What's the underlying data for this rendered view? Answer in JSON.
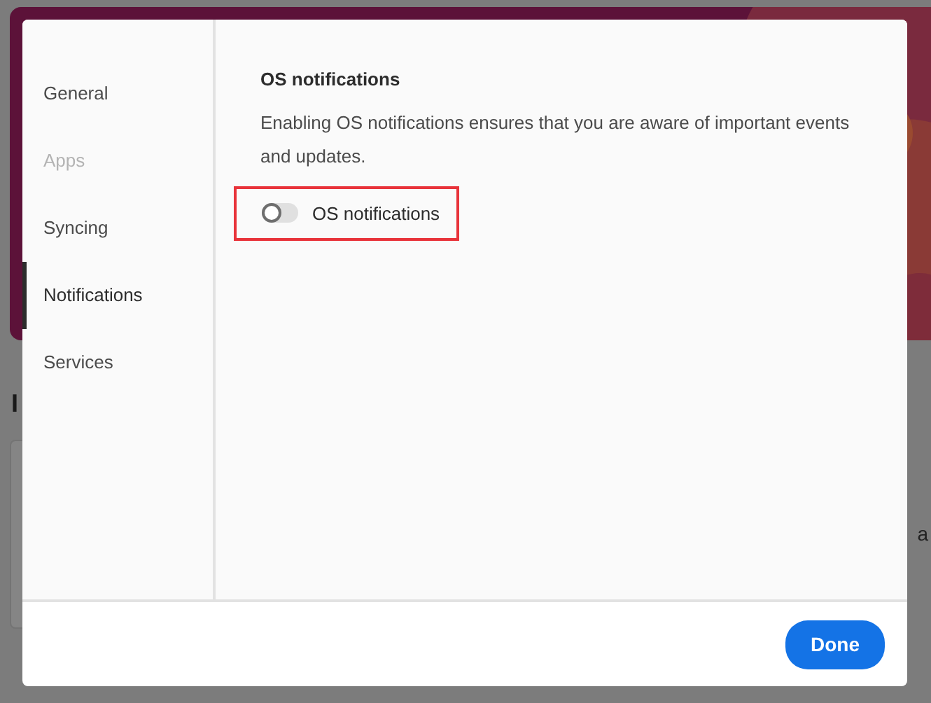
{
  "background": {
    "heading": "I",
    "side_text": "a"
  },
  "dialog": {
    "sidebar": {
      "items": [
        {
          "label": "General",
          "selected": false,
          "disabled": false
        },
        {
          "label": "Apps",
          "selected": false,
          "disabled": true
        },
        {
          "label": "Syncing",
          "selected": false,
          "disabled": false
        },
        {
          "label": "Notifications",
          "selected": true,
          "disabled": false
        },
        {
          "label": "Services",
          "selected": false,
          "disabled": false
        }
      ]
    },
    "section": {
      "title": "OS notifications",
      "description": "Enabling OS notifications ensures that you are aware of important events and updates.",
      "toggle": {
        "label": "OS notifications",
        "on": false,
        "highlighted": true
      }
    },
    "footer": {
      "done_button": "Done"
    }
  }
}
